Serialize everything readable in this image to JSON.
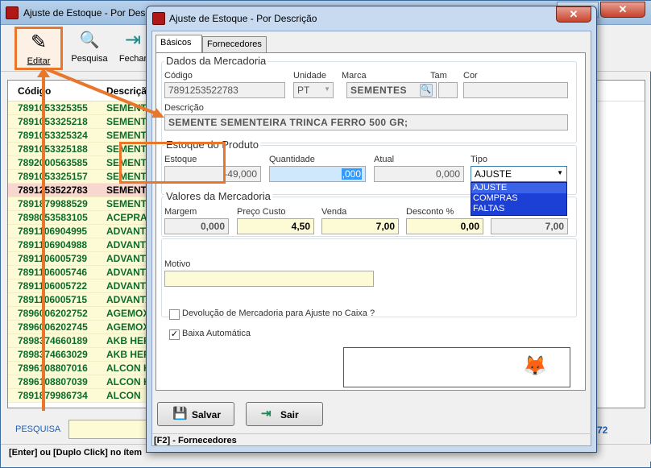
{
  "bg": {
    "title": "Ajuste de Estoque - Por Descrição",
    "close_glyph": "✕",
    "toolbar": [
      {
        "label": "Editar",
        "icon": "edit-pencil-icon",
        "glyph": "✎"
      },
      {
        "label": "Pesquisa",
        "icon": "search-icon",
        "glyph": "🔍"
      },
      {
        "label": "Fechar",
        "icon": "exit-door-icon",
        "glyph": "⇥"
      }
    ],
    "grid": {
      "columns": [
        "Código",
        "Descrição"
      ],
      "rows": [
        [
          "7891053325355",
          "SEMENTE"
        ],
        [
          "7891053325218",
          "SEMENTE"
        ],
        [
          "7891053325324",
          "SEMENTE"
        ],
        [
          "7891053325188",
          "SEMENTE"
        ],
        [
          "7892000563585",
          "SEMENTE"
        ],
        [
          "7891053325157",
          "SEMENTE"
        ],
        [
          "7891253522783",
          "SEMENTE"
        ],
        [
          "7891879988529",
          "SEMENTE"
        ],
        [
          "7898053583105",
          "ACEPRAN"
        ],
        [
          "7891106904995",
          "ADVANTAGE"
        ],
        [
          "7891106904988",
          "ADVANTAGE"
        ],
        [
          "7891106005739",
          "ADVANTAGE"
        ],
        [
          "7891106005746",
          "ADVANTAGE"
        ],
        [
          "7891106005722",
          "ADVANTAGE"
        ],
        [
          "7891106005715",
          "ADVANTAGE"
        ],
        [
          "7896006202752",
          "AGEMOXI"
        ],
        [
          "7896006202745",
          "AGEMOXI"
        ],
        [
          "7898374660189",
          "AKB HERB"
        ],
        [
          "7898374663029",
          "AKB HERB"
        ],
        [
          "7896108807016",
          "ALCON HE"
        ],
        [
          "7896108807039",
          "ALCON HE"
        ],
        [
          "7891879986734",
          "ALCON"
        ]
      ],
      "selected_index": 6
    },
    "search_label": "PESQUISA",
    "count": "72",
    "status": "[Enter] ou [Duplo Click] no ítem"
  },
  "dlg": {
    "title": "Ajuste de Estoque - Por Descrição",
    "close_glyph": "✕",
    "tabs": [
      "Básicos",
      "Fornecedores"
    ],
    "dados": {
      "title": "Dados da Mercadoria",
      "codigo_label": "Código",
      "codigo": "7891253522783",
      "unidade_label": "Unidade",
      "unidade": "PT",
      "marca_label": "Marca",
      "marca": "SEMENTES",
      "tam_label": "Tam",
      "tam": "",
      "cor_label": "Cor",
      "cor": "",
      "descricao_label": "Descrição",
      "descricao": "SEMENTE SEMENTEIRA TRINCA FERRO 500 GR;"
    },
    "estoque": {
      "title": "Estoque do Produto",
      "estoque_label": "Estoque",
      "estoque": "-49,000",
      "quantidade_label": "Quantidade",
      "quantidade": ",000",
      "atual_label": "Atual",
      "atual": "0,000",
      "tipo_label": "Tipo",
      "tipo": "AJUSTE",
      "tipo_options": [
        "AJUSTE",
        "COMPRAS",
        "FALTAS"
      ]
    },
    "valores": {
      "title": "Valores da Mercadoria",
      "margem_label": "Margem",
      "margem": "0,000",
      "custo_label": "Preço Custo",
      "custo": "4,50",
      "venda_label": "Venda",
      "venda": "7,00",
      "desconto_label": "Desconto %",
      "desconto": "0,00",
      "total": "7,00"
    },
    "motivo_label": "Motivo",
    "motivo": "",
    "devolucao_label": "Devolução de Mercadoria para Ajuste no Caixa ?",
    "devolucao_checked": false,
    "baixa_label": "Baixa Automática",
    "baixa_checked": true,
    "salvar_label": "Salvar",
    "sair_label": "Sair",
    "status": "[F2] - Fornecedores"
  },
  "accent": "#e8762b"
}
